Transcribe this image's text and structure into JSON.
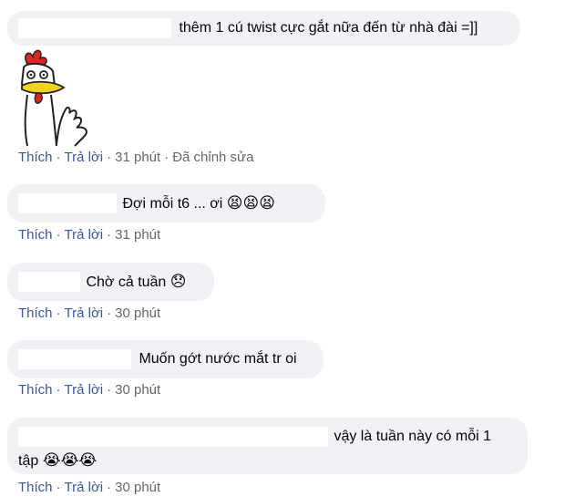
{
  "comments": [
    {
      "text": "thêm 1 cú twist cực gắt nữa đến từ nhà đài =]]",
      "like": "Thích",
      "reply": "Trả lời",
      "time": "31 phút",
      "edited": "Đã chỉnh sửa",
      "sticker": "rooster-sticker"
    },
    {
      "text": "Đợi mỗi t6 ... ơi",
      "emoji": "😫😫😫",
      "like": "Thích",
      "reply": "Trả lời",
      "time": "31 phút"
    },
    {
      "text": "Chờ cả tuần",
      "emoji": "😞",
      "like": "Thích",
      "reply": "Trả lời",
      "time": "30 phút"
    },
    {
      "text": "Muốn gớt nước mắt tr oi",
      "like": "Thích",
      "reply": "Trả lời",
      "time": "30 phút"
    },
    {
      "text": "vậy là tuần này có mỗi 1",
      "text_line2": "tập",
      "emoji": "😭😭😭",
      "like": "Thích",
      "reply": "Trả lời",
      "time": "30 phút"
    }
  ],
  "colors": {
    "bubble": "#f0f2f5",
    "action_link": "#385898",
    "meta": "#65676b"
  }
}
